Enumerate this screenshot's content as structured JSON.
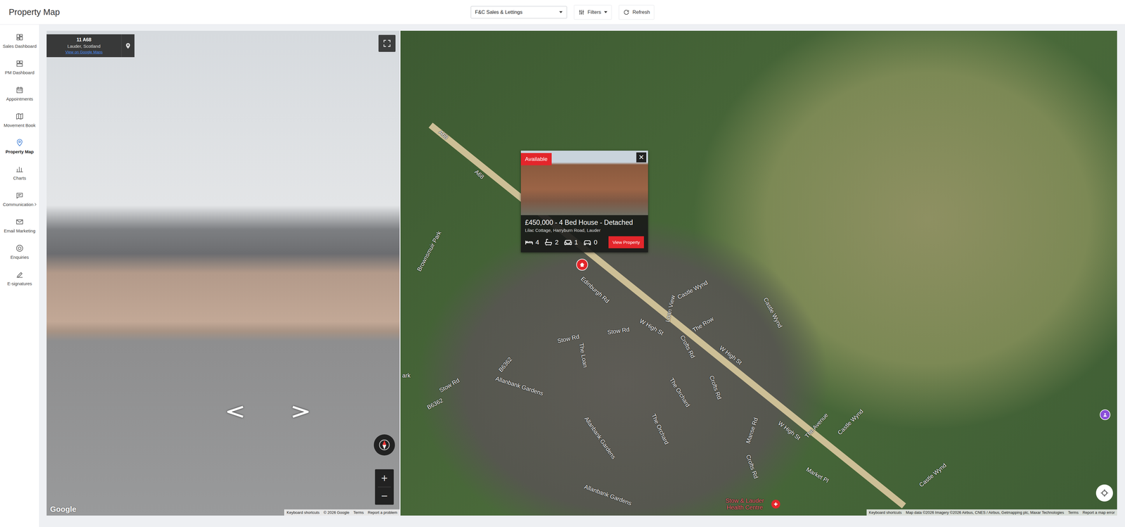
{
  "header": {
    "title": "Property Map",
    "branch": "F&C Sales & Lettings",
    "filters": "Filters",
    "refresh": "Refresh"
  },
  "sidebar": {
    "items": [
      {
        "label": "Sales Dashboard",
        "selected": false,
        "expandable": false
      },
      {
        "label": "PM Dashboard",
        "selected": false,
        "expandable": false
      },
      {
        "label": "Appointments",
        "selected": false,
        "expandable": false
      },
      {
        "label": "Movement Book",
        "selected": false,
        "expandable": false
      },
      {
        "label": "Property Map",
        "selected": true,
        "expandable": false
      },
      {
        "label": "Charts",
        "selected": false,
        "expandable": false
      },
      {
        "label": "Communication",
        "selected": false,
        "expandable": true
      },
      {
        "label": "Email Marketing",
        "selected": false,
        "expandable": false
      },
      {
        "label": "Enquiries",
        "selected": false,
        "expandable": false
      },
      {
        "label": "E-signatures",
        "selected": false,
        "expandable": false
      }
    ]
  },
  "street_view": {
    "title": "11 A68",
    "subtitle": "Lauder, Scotland",
    "link": "View on Google Maps",
    "logo": "Google",
    "zoom_in": "+",
    "zoom_out": "−",
    "footer": [
      "Keyboard shortcuts",
      "© 2026 Google",
      "Terms",
      "Report a problem"
    ]
  },
  "map": {
    "labels": [
      "A68",
      "A68",
      "Brownsmuir Park",
      "Edinburgh Rd",
      "Castle Wynd",
      "Loan View",
      "Castle Wynd",
      "Stow Rd",
      "Stow Rd",
      "W High St",
      "The Row",
      "The Loan",
      "B6362",
      "Crofts Rd",
      "W High St",
      "Allanbank Gardens",
      "Stow Rd",
      "B6362",
      "ark",
      "The Orchard",
      "The Orchard",
      "Crofts Rd",
      "Allanbank Gardens",
      "Allanbank Gardens",
      "Manse Rd",
      "Crofts Rd",
      "W High St",
      "The Avenue",
      "Castle Wynd",
      "Market Pl",
      "Castle Wynd"
    ],
    "place": "Stow & Lauder Health Centre",
    "footer": [
      "Keyboard shortcuts",
      "Map data ©2026 Imagery ©2026 Airbus, CNES / Airbus, Getmapping plc, Maxar Technologies",
      "Terms",
      "Report a map error"
    ]
  },
  "popup": {
    "status": "Available",
    "close": "×",
    "title": "£450,000 - 4 Bed House - Detached",
    "address": "Lilac Cottage, Harryburn Road, Lauder",
    "features": [
      {
        "kind": "bedrooms",
        "count": "4"
      },
      {
        "kind": "bathrooms",
        "count": "2"
      },
      {
        "kind": "receptions",
        "count": "1"
      },
      {
        "kind": "parking",
        "count": "0"
      }
    ],
    "button": "View Property"
  }
}
